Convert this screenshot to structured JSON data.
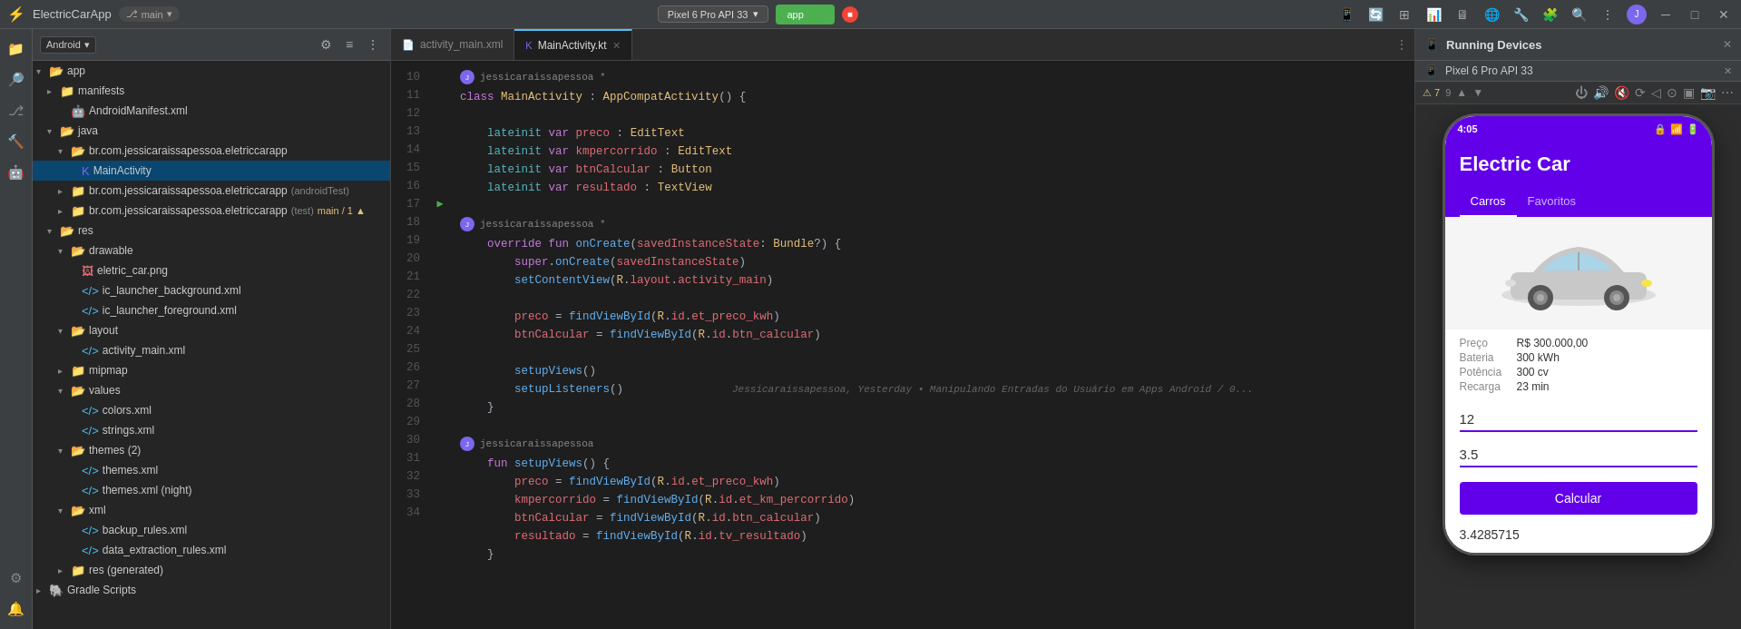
{
  "topbar": {
    "app_name": "ElectricCarApp",
    "branch": "main",
    "device": "Pixel 6 Pro API 33",
    "run_label": "app",
    "run_icon": "▶",
    "stop_color": "#f44336"
  },
  "sidebar": {
    "android_label": "Android",
    "tree": [
      {
        "id": "app",
        "label": "app",
        "level": 0,
        "type": "folder",
        "open": true
      },
      {
        "id": "manifests",
        "label": "manifests",
        "level": 1,
        "type": "folder",
        "open": false
      },
      {
        "id": "androidmanifest",
        "label": "AndroidManifest.xml",
        "level": 2,
        "type": "xml"
      },
      {
        "id": "java",
        "label": "java",
        "level": 1,
        "type": "folder",
        "open": true
      },
      {
        "id": "br-pkg",
        "label": "br.com.jessicaraissapessoa.eletriccarapp",
        "level": 2,
        "type": "folder",
        "open": true
      },
      {
        "id": "mainactivity",
        "label": "MainActivity",
        "level": 3,
        "type": "kotlin",
        "selected": true
      },
      {
        "id": "br-pkg-android",
        "label": "br.com.jessicaraissapessoa.eletriccarapp",
        "level": 2,
        "type": "folder",
        "open": false,
        "extra": "(androidTest)"
      },
      {
        "id": "br-pkg-test",
        "label": "br.com.jessicaraissapessoa.eletriccarapp",
        "level": 2,
        "type": "folder",
        "open": false,
        "extra": "(test)",
        "badge": "main / 1 ▲"
      },
      {
        "id": "res",
        "label": "res",
        "level": 1,
        "type": "folder",
        "open": true
      },
      {
        "id": "drawable",
        "label": "drawable",
        "level": 2,
        "type": "folder",
        "open": true
      },
      {
        "id": "eletric_car_png",
        "label": "eletric_car.png",
        "level": 3,
        "type": "image"
      },
      {
        "id": "ic_launcher_bg",
        "label": "ic_launcher_background.xml",
        "level": 3,
        "type": "xml"
      },
      {
        "id": "ic_launcher_fg",
        "label": "ic_launcher_foreground.xml",
        "level": 3,
        "type": "xml"
      },
      {
        "id": "layout",
        "label": "layout",
        "level": 2,
        "type": "folder",
        "open": true
      },
      {
        "id": "activity_main_xml",
        "label": "activity_main.xml",
        "level": 3,
        "type": "xml"
      },
      {
        "id": "mipmap",
        "label": "mipmap",
        "level": 2,
        "type": "folder",
        "open": false
      },
      {
        "id": "values",
        "label": "values",
        "level": 2,
        "type": "folder",
        "open": true
      },
      {
        "id": "colors_xml",
        "label": "colors.xml",
        "level": 3,
        "type": "xml"
      },
      {
        "id": "strings_xml",
        "label": "strings.xml",
        "level": 3,
        "type": "xml"
      },
      {
        "id": "themes",
        "label": "themes (2)",
        "level": 2,
        "type": "folder",
        "open": true
      },
      {
        "id": "themes_xml",
        "label": "themes.xml",
        "level": 3,
        "type": "xml"
      },
      {
        "id": "themes_xml_night",
        "label": "themes.xml (night)",
        "level": 3,
        "type": "xml"
      },
      {
        "id": "xml",
        "label": "xml",
        "level": 2,
        "type": "folder",
        "open": true
      },
      {
        "id": "backup_rules",
        "label": "backup_rules.xml",
        "level": 3,
        "type": "xml"
      },
      {
        "id": "data_extraction",
        "label": "data_extraction_rules.xml",
        "level": 3,
        "type": "xml"
      },
      {
        "id": "res_generated",
        "label": "res (generated)",
        "level": 2,
        "type": "folder",
        "open": false
      },
      {
        "id": "gradle_scripts",
        "label": "Gradle Scripts",
        "level": 0,
        "type": "folder",
        "open": false
      }
    ]
  },
  "tabs": [
    {
      "id": "activity_main_xml",
      "label": "activity_main.xml",
      "active": false,
      "icon": "📄"
    },
    {
      "id": "mainactivity_kt",
      "label": "MainActivity.kt",
      "active": true,
      "icon": "🔷"
    }
  ],
  "editor": {
    "lines": [
      {
        "num": 10,
        "gutter": "",
        "code": "<span class='kw'>class</span> <span class='cls'>MainActivity</span> <span class='punc'>:</span> <span class='cls'>AppCompatActivity</span><span class='punc'>() {</span>"
      },
      {
        "num": 11,
        "gutter": "",
        "code": ""
      },
      {
        "num": 12,
        "gutter": "",
        "code": "    <span class='kw2'>lateinit</span> <span class='kw'>var</span> <span class='var'>preco</span> <span class='punc'>:</span> <span class='type'>EditText</span>"
      },
      {
        "num": 13,
        "gutter": "",
        "code": "    <span class='kw2'>lateinit</span> <span class='kw'>var</span> <span class='var'>kmpercorrido</span> <span class='punc'>:</span> <span class='type'>EditText</span>"
      },
      {
        "num": 14,
        "gutter": "",
        "code": "    <span class='kw2'>lateinit</span> <span class='kw'>var</span> <span class='var'>btnCalcular</span> <span class='punc'>:</span> <span class='type'>Button</span>"
      },
      {
        "num": 15,
        "gutter": "",
        "code": "    <span class='kw2'>lateinit</span> <span class='kw'>var</span> <span class='var'>resultado</span> <span class='punc'>:</span> <span class='type'>TextView</span>"
      },
      {
        "num": 16,
        "gutter": "",
        "code": ""
      },
      {
        "num": 17,
        "gutter": "▶",
        "code": "    <span class='kw'>override</span> <span class='kw'>fun</span> <span class='fn'>onCreate</span><span class='punc'>(</span><span class='var'>savedInstanceState</span><span class='punc'>:</span> <span class='type'>Bundle</span><span class='punc'>?) {</span>"
      },
      {
        "num": 18,
        "gutter": "",
        "code": "        <span class='kw'>super</span><span class='punc'>.</span><span class='fn'>onCreate</span><span class='punc'>(</span><span class='var'>savedInstanceState</span><span class='punc'>)</span>"
      },
      {
        "num": 19,
        "gutter": "",
        "code": "        <span class='fn'>setContentView</span><span class='punc'>(</span><span class='cls'>R</span><span class='punc'>.</span><span class='var'>layout</span><span class='punc'>.</span><span class='var'>activity_main</span><span class='punc'>)</span>"
      },
      {
        "num": 20,
        "gutter": "",
        "code": ""
      },
      {
        "num": 21,
        "gutter": "",
        "code": "        <span class='var'>preco</span> <span class='punc'>=</span> <span class='fn'>findViewById</span><span class='punc'>(</span><span class='cls'>R</span><span class='punc'>.</span><span class='var'>id</span><span class='punc'>.</span><span class='var'>et_preco_kwh</span><span class='punc'>)</span>"
      },
      {
        "num": 22,
        "gutter": "",
        "code": "        <span class='var'>btnCalcular</span> <span class='punc'>=</span> <span class='fn'>findViewById</span><span class='punc'>(</span><span class='cls'>R</span><span class='punc'>.</span><span class='var'>id</span><span class='punc'>.</span><span class='var'>btn_calcular</span><span class='punc'>)</span>"
      },
      {
        "num": 23,
        "gutter": "",
        "code": ""
      },
      {
        "num": 24,
        "gutter": "",
        "code": "        <span class='fn'>setupViews</span><span class='punc'>()</span>"
      },
      {
        "num": 25,
        "gutter": "",
        "code": "        <span class='fn'>setupListeners</span><span class='punc'>()</span>",
        "commit": "Jessicaraissapessoa, Yesterday • Manipulando Entradas do Usuário em Apps Android / 0..."
      },
      {
        "num": 26,
        "gutter": "",
        "code": "    <span class='punc'>}</span>"
      },
      {
        "num": 27,
        "gutter": "",
        "code": ""
      },
      {
        "num": 28,
        "gutter": "",
        "code": "    <span class='kw'>fun</span> <span class='fn'>setupViews</span><span class='punc'>() {</span>"
      },
      {
        "num": 29,
        "gutter": "",
        "code": "        <span class='var'>preco</span> <span class='punc'>=</span> <span class='fn'>findViewById</span><span class='punc'>(</span><span class='cls'>R</span><span class='punc'>.</span><span class='var'>id</span><span class='punc'>.</span><span class='var'>et_preco_kwh</span><span class='punc'>)</span>"
      },
      {
        "num": 30,
        "gutter": "",
        "code": "        <span class='var'>kmpercorrido</span> <span class='punc'>=</span> <span class='fn'>findViewById</span><span class='punc'>(</span><span class='cls'>R</span><span class='punc'>.</span><span class='var'>id</span><span class='punc'>.</span><span class='var'>et_km_percorrido</span><span class='punc'>)</span>"
      },
      {
        "num": 31,
        "gutter": "",
        "code": "        <span class='var'>btnCalcular</span> <span class='punc'>=</span> <span class='fn'>findViewById</span><span class='punc'>(</span><span class='cls'>R</span><span class='punc'>.</span><span class='var'>id</span><span class='punc'>.</span><span class='var'>btn_calcular</span><span class='punc'>)</span>"
      },
      {
        "num": 32,
        "gutter": "",
        "code": "        <span class='var'>resultado</span> <span class='punc'>=</span> <span class='fn'>findViewById</span><span class='punc'>(</span><span class='cls'>R</span><span class='punc'>.</span><span class='var'>id</span><span class='punc'>.</span><span class='var'>tv_resultado</span><span class='punc'>)</span>"
      },
      {
        "num": 33,
        "gutter": "",
        "code": "    <span class='punc'>}</span>"
      },
      {
        "num": 34,
        "gutter": "",
        "code": ""
      }
    ],
    "comments": [
      {
        "line_after": 16,
        "user": "jessicaraissapessoa",
        "text": "*",
        "type": "avatar"
      },
      {
        "line_after": 27,
        "user": "jessicaraissapessoa",
        "text": "*",
        "type": "avatar"
      },
      {
        "line_after": 29,
        "user": "jessicaraissapessoa",
        "text": "",
        "type": "avatar"
      }
    ]
  },
  "device_panel": {
    "title": "Running Devices",
    "device_name": "Pixel 6 Pro API 33",
    "phone": {
      "time": "4:05",
      "battery_icon": "🔋",
      "signal_icon": "📶",
      "app_title": "Electric Car",
      "tabs": [
        "Carros",
        "Favoritos"
      ],
      "active_tab": "Carros",
      "car_specs": [
        {
          "label": "Preço",
          "value": "R$ 300.000,00"
        },
        {
          "label": "Bateria",
          "value": "300 kWh"
        },
        {
          "label": "Potência",
          "value": "300 cv"
        },
        {
          "label": "Recarga",
          "value": "23 min"
        }
      ],
      "input1": "12",
      "input2": "3.5",
      "btn_label": "Calcular",
      "result": "3.4285715"
    }
  }
}
